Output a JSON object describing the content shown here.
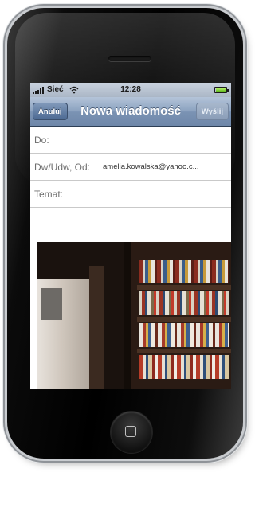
{
  "status_bar": {
    "carrier": "Sieć",
    "time": "12:28"
  },
  "nav": {
    "title": "Nowa wiadomość",
    "cancel_label": "Anuluj",
    "send_label": "Wyślij"
  },
  "fields": {
    "to_label": "Do:",
    "cc_label": "Dw/Udw, Od:",
    "from_value": "amelia.kowalska@yahoo.c...",
    "subject_label": "Temat:"
  },
  "colors": {
    "nav_bar": "#7b93b4",
    "status_bar": "#aab6c6",
    "battery": "#5fb71c"
  },
  "icons": [
    "signal-icon",
    "wifi-icon",
    "battery-icon",
    "home-button-icon"
  ]
}
